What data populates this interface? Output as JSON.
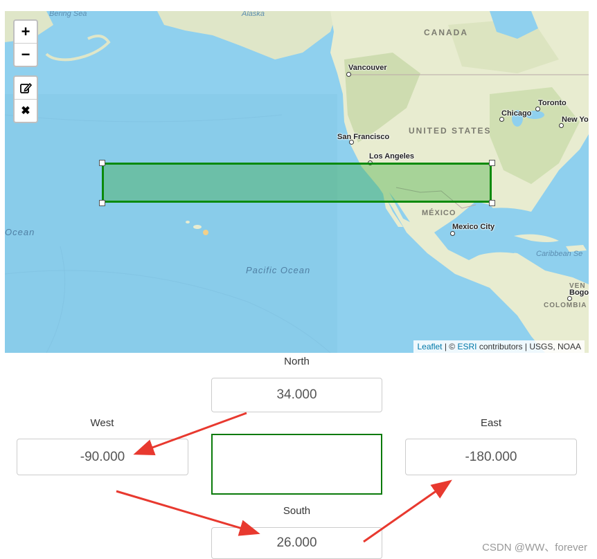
{
  "map": {
    "zoom_controls": {
      "zoom_in": "+",
      "zoom_out": "−"
    },
    "draw_controls": {
      "edit": "edit-icon",
      "delete": "✖"
    },
    "labels": {
      "bering_sea": "Bering Sea",
      "alaska": "Alaska",
      "canada": "CANADA",
      "united_states": "UNITED STATES",
      "mexico": "MÉXICO",
      "pacific_ocean": "Pacific Ocean",
      "ocean_left": "Ocean",
      "caribbean_sea": "Caribbean Se",
      "colombia": "COLOMBIA",
      "venezuela": "VEN",
      "vancouver": "Vancouver",
      "san_francisco": "San Francisco",
      "los_angeles": "Los Angeles",
      "chicago": "Chicago",
      "toronto": "Toronto",
      "new_york": "New Yo",
      "mexico_city": "Mexico City",
      "bogota": "Bogota"
    },
    "attribution": {
      "leaflet": "Leaflet",
      "separator": " | © ",
      "esri": "ESRI",
      "rest": " contributors | USGS, NOAA"
    },
    "colors": {
      "water": "#8fd0ee",
      "land": "#e8ecd0",
      "bbox": "#0a8a0a"
    }
  },
  "form": {
    "north": {
      "label": "North",
      "value": "34.000"
    },
    "west": {
      "label": "West",
      "value": "-90.000"
    },
    "east": {
      "label": "East",
      "value": "-180.000"
    },
    "south": {
      "label": "South",
      "value": "26.000"
    }
  },
  "watermark": "CSDN @WW、forever"
}
